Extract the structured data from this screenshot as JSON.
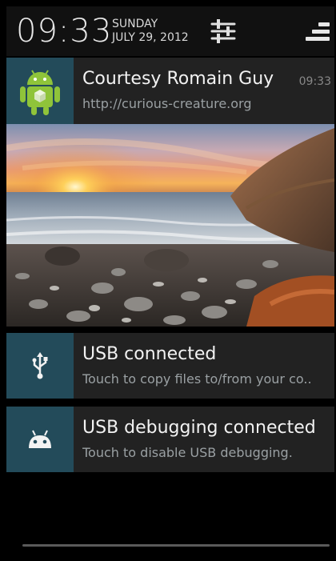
{
  "status": {
    "time": "09:33",
    "day": "SUNDAY",
    "date": "JULY 29, 2012",
    "settings_icon": "settings-sliders-icon",
    "clear_icon": "clear-all-icon"
  },
  "notifications": [
    {
      "title": "Courtesy Romain Guy",
      "subtitle": "http://curious-creature.org",
      "time": "09:33",
      "icon": "android-robot-icon"
    },
    {
      "title": "USB connected",
      "subtitle": "Touch to copy files to/from your co..",
      "icon": "usb-icon"
    },
    {
      "title": "USB debugging connected",
      "subtitle": "Touch to disable USB debugging.",
      "icon": "android-debug-icon"
    }
  ],
  "colors": {
    "icon_tile": "#234b5a",
    "panel": "#222222",
    "background": "#000000"
  }
}
